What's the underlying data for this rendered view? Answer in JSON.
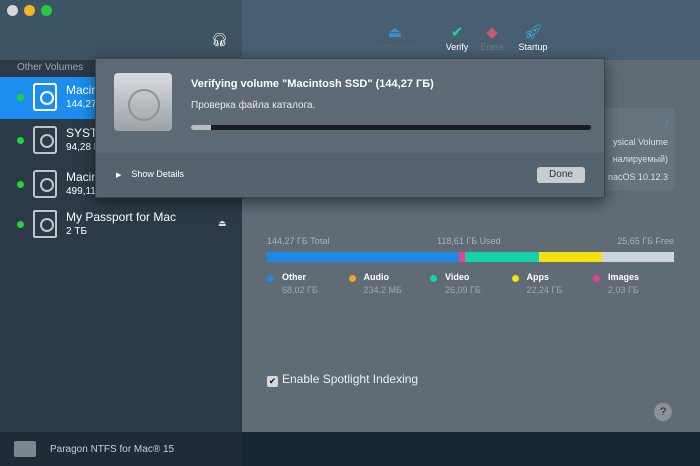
{
  "sidebar": {
    "section": "Other Volumes",
    "items": [
      {
        "name": "Macintosh SSD",
        "size": "144,27 ГБ",
        "selected": true,
        "mounted": true
      },
      {
        "name": "SYSTEM",
        "size": "94,28 ГБ",
        "mounted": true
      },
      {
        "name": "Macintosh HD",
        "size": "499,11 ГБ",
        "mounted": true
      },
      {
        "name": "My Passport for Mac",
        "size": "2 ТБ",
        "mounted": true
      }
    ],
    "footer": "Paragon NTFS for Mac® 15"
  },
  "toolbar": {
    "unmount": "Unmount",
    "verify": "Verify",
    "erase": "Erase",
    "startup": "Startup"
  },
  "info": {
    "mount": "/",
    "type": "ysical Volume",
    "format": "налируемый)",
    "os": "nacOS 10.12.3"
  },
  "usage": {
    "total": "144,27 ГБ Total",
    "used": "118,61 ГБ Used",
    "free": "25,65 ГБ Free",
    "segments": [
      {
        "name": "Other",
        "value": "68,02 ГБ",
        "gb": 68.02,
        "color": "#1f8ae6"
      },
      {
        "name": "Audio",
        "value": "234,2 МБ",
        "gb": 0.234,
        "color": "#f5a623"
      },
      {
        "name": "Video",
        "value": "26,09 ГБ",
        "gb": 26.09,
        "color": "#16d2aa"
      },
      {
        "name": "Apps",
        "value": "22,24 ГБ",
        "gb": 22.24,
        "color": "#f5e010"
      },
      {
        "name": "Images",
        "value": "2,03 ГБ",
        "gb": 2.03,
        "color": "#ec3e92"
      }
    ],
    "free_gb": 25.65,
    "free_color": "#cfd5dc"
  },
  "spotlight": {
    "label": "Enable Spotlight Indexing",
    "checked": true
  },
  "dialog": {
    "title": "Verifying volume \"Macintosh SSD\" (144,27 ГБ)",
    "status": "Проверка файла каталога.",
    "progress": 0.05,
    "show_details": "Show Details",
    "done": "Done"
  }
}
